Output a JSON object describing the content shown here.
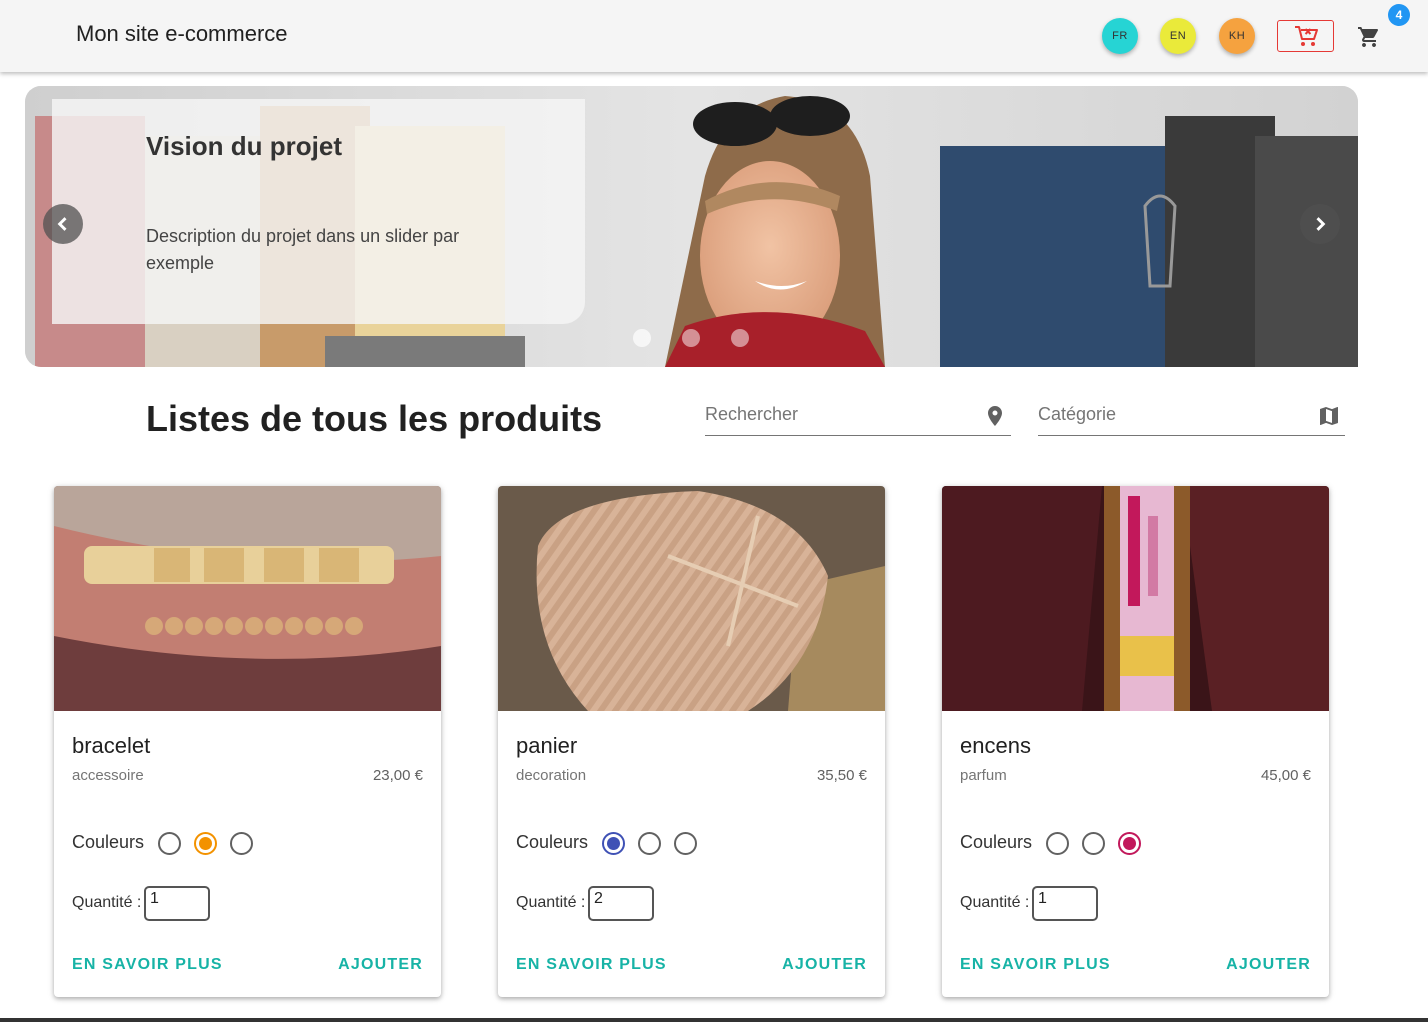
{
  "header": {
    "title": "Mon site e-commerce",
    "languages": [
      {
        "code": "FR",
        "color": "#26d4d4"
      },
      {
        "code": "EN",
        "color": "#eaea3a"
      },
      {
        "code": "KH",
        "color": "#f5a23f"
      }
    ],
    "clear_cart_icon": "remove-shopping-cart-icon",
    "cart_icon": "shopping-cart-icon",
    "cart_count": "4"
  },
  "hero": {
    "title": "Vision du projet",
    "description": "Description du projet dans un slider par exemple",
    "slide_count": 3,
    "active_slide": 1
  },
  "products_section": {
    "title": "Listes de tous les produits",
    "search_placeholder": "Rechercher",
    "search_icon": "place-icon",
    "category_placeholder": "Catégorie",
    "category_icon": "map-icon"
  },
  "products": [
    {
      "name": "bracelet",
      "category": "accessoire",
      "price": "23,00 €",
      "colors_label": "Couleurs",
      "colors": [
        "#616161",
        "#f39200",
        "#616161"
      ],
      "selected_color": 1,
      "quantity_label": "Quantité :",
      "quantity": "1",
      "more_label": "EN SAVOIR PLUS",
      "add_label": "AJOUTER"
    },
    {
      "name": "panier",
      "category": "decoration",
      "price": "35,50 €",
      "colors_label": "Couleurs",
      "colors": [
        "#3f51b5",
        "#616161",
        "#616161"
      ],
      "selected_color": 0,
      "quantity_label": "Quantité :",
      "quantity": "2",
      "more_label": "EN SAVOIR PLUS",
      "add_label": "AJOUTER"
    },
    {
      "name": "encens",
      "category": "parfum",
      "price": "45,00 €",
      "colors_label": "Couleurs",
      "colors": [
        "#616161",
        "#616161",
        "#c2185b"
      ],
      "selected_color": 2,
      "quantity_label": "Quantité :",
      "quantity": "1",
      "more_label": "EN SAVOIR PLUS",
      "add_label": "AJOUTER"
    }
  ],
  "colors": {
    "accent": "#17b3a6",
    "badge": "#2196f3",
    "danger": "#e53935"
  }
}
